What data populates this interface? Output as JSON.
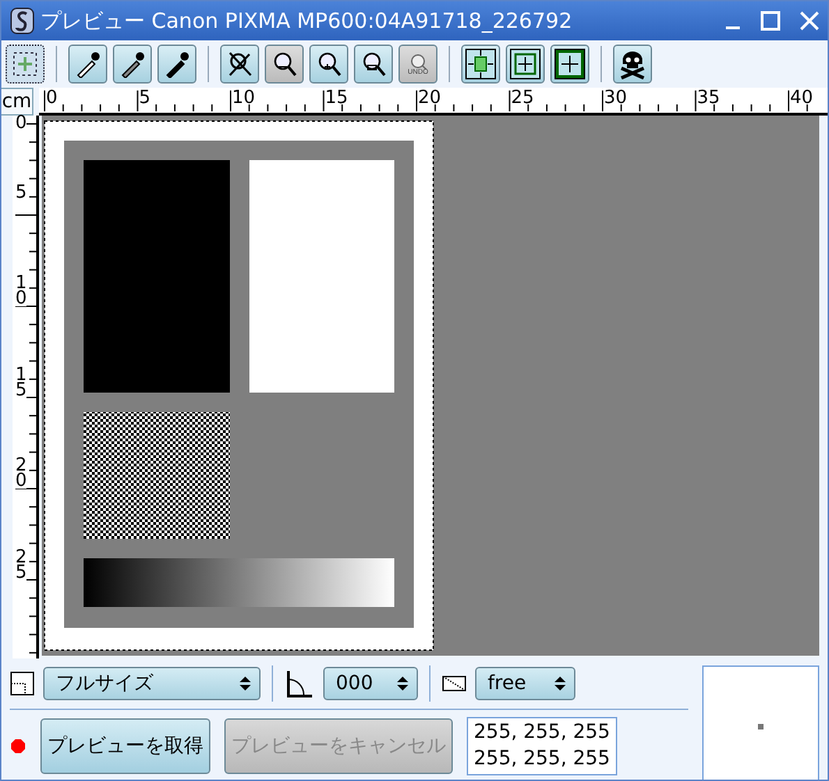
{
  "window": {
    "title": "プレビュー Canon PIXMA MP600:04A91718_226792"
  },
  "toolbar": [
    {
      "kind": "select",
      "disabled": false,
      "selected": true
    },
    {
      "kind": "pipette-white",
      "disabled": false,
      "selected": false
    },
    {
      "kind": "pipette-gray",
      "disabled": false,
      "selected": false
    },
    {
      "kind": "pipette-black",
      "disabled": false,
      "selected": false
    },
    {
      "kind": "zoom-none",
      "disabled": false,
      "selected": false
    },
    {
      "kind": "zoom-out",
      "disabled": true,
      "selected": false
    },
    {
      "kind": "zoom-in",
      "disabled": false,
      "selected": false
    },
    {
      "kind": "zoom-area",
      "disabled": false,
      "selected": false
    },
    {
      "kind": "zoom-undo",
      "label": "UNDO",
      "disabled": true,
      "selected": false
    },
    {
      "kind": "autoselect",
      "disabled": false,
      "selected": false
    },
    {
      "kind": "select-visible",
      "disabled": false,
      "selected": false
    },
    {
      "kind": "select-all",
      "disabled": false,
      "selected": false
    },
    {
      "kind": "delete-images",
      "disabled": false,
      "selected": false
    }
  ],
  "ruler": {
    "unit": "cm",
    "x_labels": [
      "0",
      "5",
      "10",
      "15",
      "20",
      "25",
      "30",
      "35",
      "40"
    ],
    "y_labels": [
      "0",
      "5",
      "10",
      "15",
      "20",
      "25"
    ]
  },
  "size_select": {
    "value": "フルサイズ"
  },
  "rotation_select": {
    "value": "000"
  },
  "aspect_select": {
    "value": "free"
  },
  "buttons": [
    {
      "label": "プレビューを取得",
      "disabled": false
    },
    {
      "label": "プレビューをキャンセル",
      "disabled": true
    }
  ],
  "pixel_values": [
    "255, 255, 255",
    "255, 255, 255"
  ]
}
